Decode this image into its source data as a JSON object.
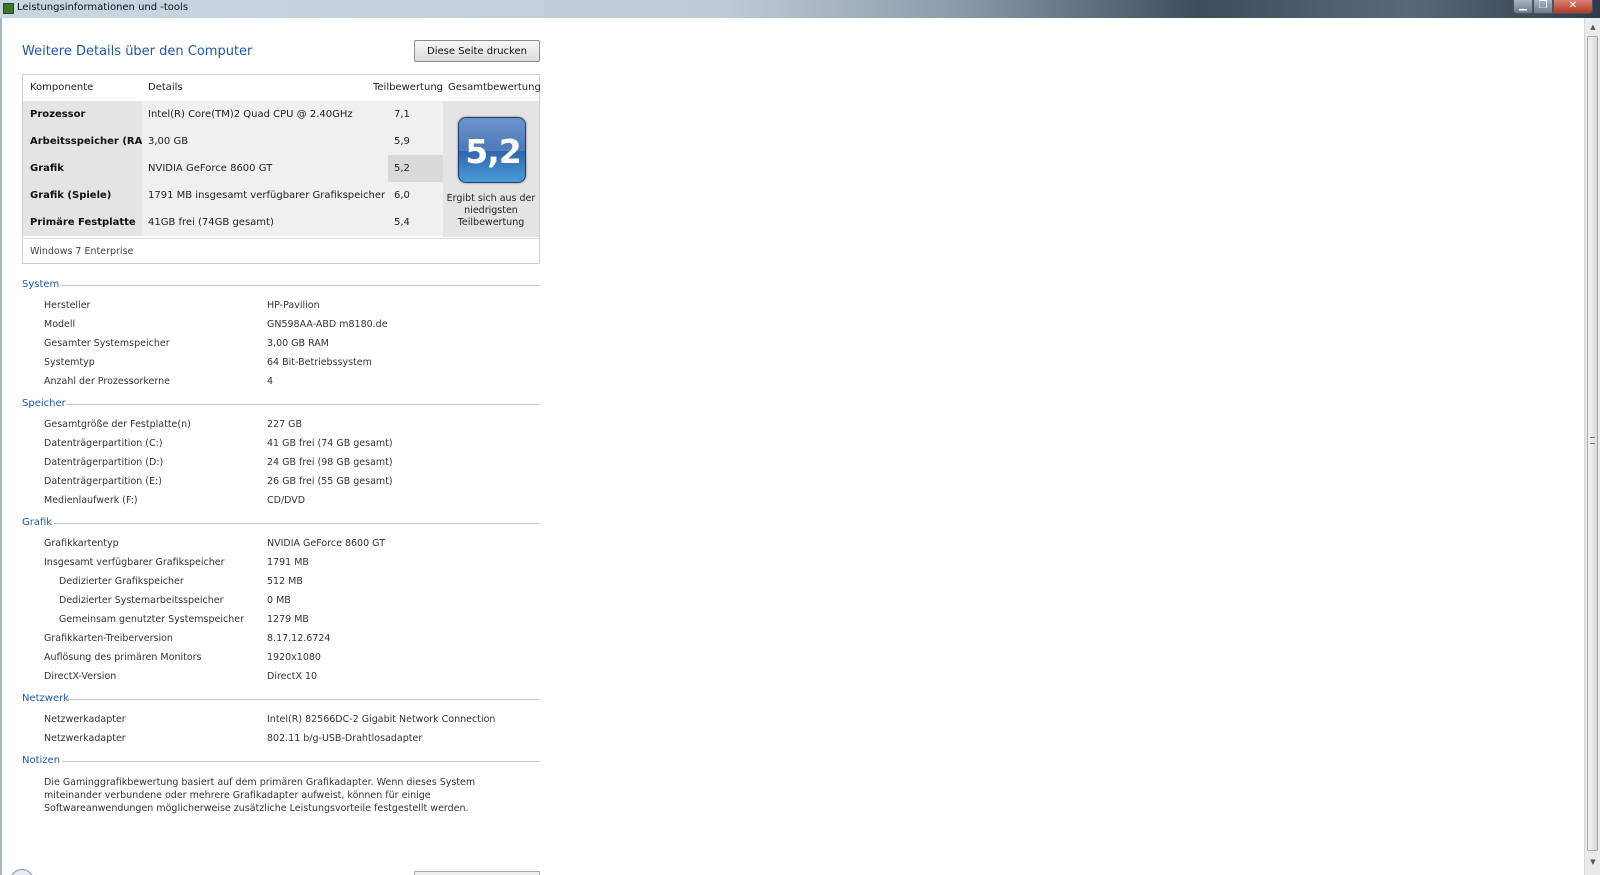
{
  "window": {
    "title": "Leistungsinformationen und -tools"
  },
  "heading": "Weitere Details über den Computer",
  "print_button": "Diese Seite drucken",
  "score_table": {
    "headers": {
      "component": "Komponente",
      "details": "Details",
      "subscore": "Teilbewertung",
      "base": "Gesamtbewertung"
    },
    "rows": [
      {
        "component": "Prozessor",
        "details": "Intel(R) Core(TM)2 Quad CPU @ 2.40GHz",
        "score": "7,1"
      },
      {
        "component": "Arbeitsspeicher (RAM)",
        "details": "3,00 GB",
        "score": "5,9"
      },
      {
        "component": "Grafik",
        "details": "NVIDIA GeForce 8600 GT",
        "score": "5,2"
      },
      {
        "component": "Grafik (Spiele)",
        "details": "1791 MB insgesamt verfügbarer Grafikspeicher",
        "score": "6,0"
      },
      {
        "component": "Primäre Festplatte",
        "details": "41GB frei (74GB gesamt)",
        "score": "5,4"
      }
    ],
    "base_score": "5,2",
    "base_note": "Ergibt sich aus der niedrigsten Teilbewertung",
    "os": "Windows 7 Enterprise"
  },
  "sections": {
    "system": {
      "title": "System",
      "items": [
        {
          "label": "Hersteller",
          "value": "HP-Pavilion"
        },
        {
          "label": "Modell",
          "value": "GN598AA-ABD m8180.de"
        },
        {
          "label": "Gesamter Systemspeicher",
          "value": "3,00 GB RAM"
        },
        {
          "label": "Systemtyp",
          "value": "64 Bit-Betriebssystem"
        },
        {
          "label": "Anzahl der Prozessorkerne",
          "value": "4"
        }
      ]
    },
    "storage": {
      "title": "Speicher",
      "items": [
        {
          "label": "Gesamtgröße der Festplatte(n)",
          "value": "227 GB"
        },
        {
          "label": "Datenträgerpartition (C:)",
          "value": "41 GB frei (74 GB gesamt)"
        },
        {
          "label": "Datenträgerpartition (D:)",
          "value": "24 GB frei (98 GB gesamt)"
        },
        {
          "label": "Datenträgerpartition (E:)",
          "value": "26 GB frei (55 GB gesamt)"
        },
        {
          "label": "Medienlaufwerk (F:)",
          "value": "CD/DVD"
        }
      ]
    },
    "graphics": {
      "title": "Grafik",
      "items": [
        {
          "label": "Grafikkartentyp",
          "value": "NVIDIA GeForce 8600 GT"
        },
        {
          "label": "Insgesamt verfügbarer Grafikspeicher",
          "value": "1791 MB"
        },
        {
          "label": "Dedizierter Grafikspeicher",
          "value": "512 MB"
        },
        {
          "label": "Dedizierter Systemarbeitsspeicher",
          "value": "0 MB"
        },
        {
          "label": "Gemeinsam genutzter Systemspeicher",
          "value": "1279 MB"
        },
        {
          "label": "Grafikkarten-Treiberversion",
          "value": "8.17.12.6724"
        },
        {
          "label": "Auflösung des primären Monitors",
          "value": "1920x1080"
        },
        {
          "label": "DirectX-Version",
          "value": "DirectX 10"
        }
      ]
    },
    "network": {
      "title": "Netzwerk",
      "items": [
        {
          "label": "Netzwerkadapter",
          "value": "Intel(R) 82566DC-2 Gigabit Network Connection"
        },
        {
          "label": "Netzwerkadapter",
          "value": "802.11 b/g-USB-Drahtlosadapter"
        }
      ]
    },
    "notes": {
      "title": "Notizen",
      "text": "Die Gaminggrafikbewertung basiert auf dem primären Grafikadapter. Wenn dieses System miteinander verbundene oder mehrere Grafikadapter aufweist, können für einige Softwareanwendungen möglicherweise zusätzliche Leistungsvorteile festgestellt werden."
    }
  },
  "icons": {
    "minimize": "minimize-icon",
    "maximize": "maximize-icon",
    "close": "close-icon",
    "scroll_up": "arrow-up-icon",
    "scroll_down": "arrow-down-icon"
  }
}
